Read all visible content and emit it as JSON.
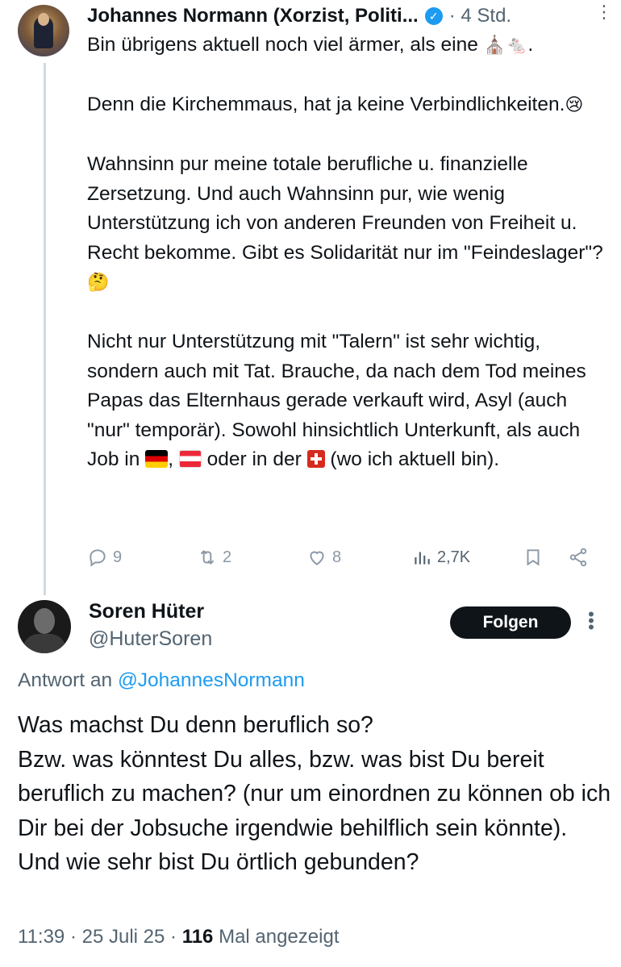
{
  "tweet1": {
    "author_name": "Johannes Normann (Xorzist, Politi...",
    "separator": "·",
    "time": "4 Std.",
    "more": "⋮",
    "line1_text": "Bin übrigens aktuell noch viel ärmer, als eine",
    "line1_emoji": "⛪🐁.",
    "para2_text": "Denn die Kirchemmaus, hat ja keine Verbindlichkeiten.",
    "para2_emoji": "😢",
    "para3_text": "Wahnsinn pur meine totale berufliche u. finanzielle Zersetzung. Und auch Wahnsinn pur, wie wenig Unterstützung ich von anderen Freunden von Freiheit u. Recht bekomme. Gibt es Solidarität nur im \"Feindeslager\"?",
    "para3_emoji": "🤔",
    "para4_text": "Nicht nur Unterstützung mit \"Talern\" ist sehr wichtig, sondern auch mit Tat. Brauche, da nach dem Tod meines Papas das Elternhaus gerade verkauft wird, Asyl (auch \"nur\" temporär). Sowohl hinsichtlich Unterkunft, als auch Job in",
    "para4_mid": ",",
    "para4_oder": "oder in der",
    "para4_end": "(wo ich aktuell bin).",
    "actions": {
      "replies": "9",
      "reposts": "2",
      "likes": "8",
      "views": "2,7K"
    }
  },
  "tweet2": {
    "author_name": "Soren Hüter",
    "handle": "@HuterSoren",
    "follow_label": "Folgen",
    "more": "⋮",
    "reply_prefix": "Antwort an",
    "reply_mention": "@JohannesNormann",
    "line1": "Was machst Du denn beruflich so?",
    "line2": "Bzw. was könntest Du alles, bzw. was bist Du bereit beruflich zu machen? (nur um einordnen zu können ob ich Dir bei der Jobsuche irgendwie behilflich sein könnte).",
    "line3": "Und wie sehr bist Du örtlich gebunden?",
    "meta_time": "11:39 · 25 Juli 25 ·",
    "meta_views": "116",
    "meta_suffix": "Mal angezeigt"
  },
  "colors": {
    "text": "#0f1419",
    "secondary": "#536471",
    "accent": "#1d9bf0",
    "thread_line": "#cfd9de"
  },
  "icons": [
    "verified-badge-icon",
    "reply-icon",
    "repost-icon",
    "like-icon",
    "views-icon",
    "bookmark-icon",
    "share-icon",
    "more-icon"
  ]
}
